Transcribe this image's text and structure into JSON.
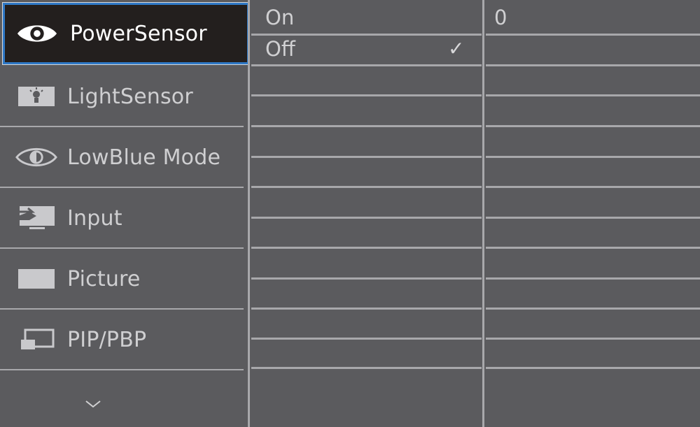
{
  "menu": {
    "items": [
      {
        "label": "PowerSensor",
        "icon": "eye-icon",
        "selected": true
      },
      {
        "label": "LightSensor",
        "icon": "light-sensor-icon"
      },
      {
        "label": "LowBlue Mode",
        "icon": "eye-icon"
      },
      {
        "label": "Input",
        "icon": "input-icon"
      },
      {
        "label": "Picture",
        "icon": "picture-icon"
      },
      {
        "label": "PIP/PBP",
        "icon": "pip-pbp-icon"
      }
    ],
    "more_icon": "chevron-down-icon"
  },
  "submenu": {
    "options": [
      {
        "label": "On",
        "checked": false
      },
      {
        "label": "Off",
        "checked": true
      }
    ],
    "check_glyph": "✓"
  },
  "value_panel": {
    "value": "0"
  },
  "colors": {
    "background": "#5b5b5e",
    "selected_bg": "#231f1e",
    "selected_border": "#2e78c6",
    "divider": "#a8a8ab",
    "text": "#cfcfd1"
  }
}
